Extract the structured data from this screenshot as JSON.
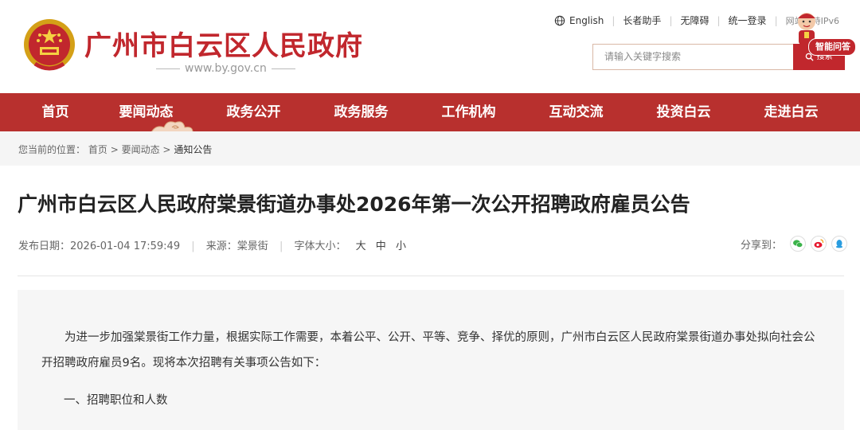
{
  "header": {
    "site_title": "广州市白云区人民政府",
    "site_url": "www.by.gov.cn",
    "toplinks": [
      "English",
      "长者助手",
      "无障碍",
      "统一登录"
    ],
    "ipv6_label": "网站支持IPv6",
    "search_placeholder": "请输入关键字搜索",
    "search_button": "搜索",
    "smart_qa": "智能问答"
  },
  "nav": {
    "items": [
      "首页",
      "要闻动态",
      "政务公开",
      "政务服务",
      "工作机构",
      "互动交流",
      "投资白云",
      "走进白云"
    ],
    "active_index": 1
  },
  "breadcrumb": {
    "prefix": "您当前的位置：",
    "items": [
      "首页",
      "要闻动态",
      "通知公告"
    ],
    "separator": ">"
  },
  "article": {
    "title": "广州市白云区人民政府棠景街道办事处2026年第一次公开招聘政府雇员公告",
    "date_label": "发布日期：",
    "date": "2026-01-04 17:59:49",
    "source_label": "来源：",
    "source": "棠景街",
    "font_label": "字体大小：",
    "font_sizes": [
      "大",
      "中",
      "小"
    ],
    "share_label": "分享到：",
    "share_icons": [
      "wechat-icon",
      "weibo-icon",
      "qq-icon"
    ],
    "paragraph": "为进一步加强棠景街工作力量，根据实际工作需要，本着公平、公开、平等、竞争、择优的原则，广州市白云区人民政府棠景街道办事处拟向社会公开招聘政府雇员9名。现将本次招聘有关事项公告如下：",
    "section1": "一、招聘职位和人数"
  },
  "colors": {
    "brand_red": "#b8302e",
    "title_red": "#c1272d"
  }
}
